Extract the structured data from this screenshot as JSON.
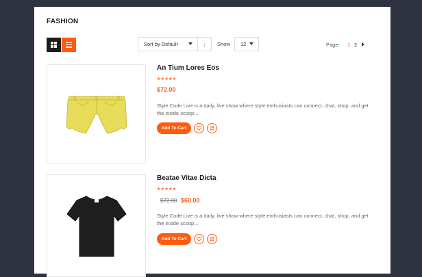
{
  "page": {
    "title": "FASHION"
  },
  "toolbar": {
    "view_grid_icon": "grid-icon",
    "view_list_icon": "list-icon",
    "sort_value": "Sort by Default",
    "sort_direction_icon": "↓",
    "show_label": "Show",
    "show_value": "12",
    "page_label": "Page:",
    "pages": [
      "1",
      "2"
    ],
    "current_page": "1"
  },
  "products": [
    {
      "name": "An Tium Lores Eos",
      "stars": "★★★★★",
      "price": "$72.00",
      "old_price": "",
      "description": "Style Code Live is a daily, live show where style enthusiasts can connect, chat, shop, and get the inside scoop...",
      "cart_label": "Add To Cart",
      "image": "yellow-shorts"
    },
    {
      "name": "Beatae Vitae Dicta",
      "stars": "★★★★★",
      "price": "$60.00",
      "old_price": "$72.00",
      "description": "Style Code Live is a daily, live show where style enthusiasts can connect, chat, shop, and get the inside scoop...",
      "cart_label": "Add To Cart",
      "image": "black-tshirt"
    }
  ],
  "colors": {
    "accent": "#ff5a10",
    "background": "#2f3340",
    "dark": "#1d1d1d"
  }
}
